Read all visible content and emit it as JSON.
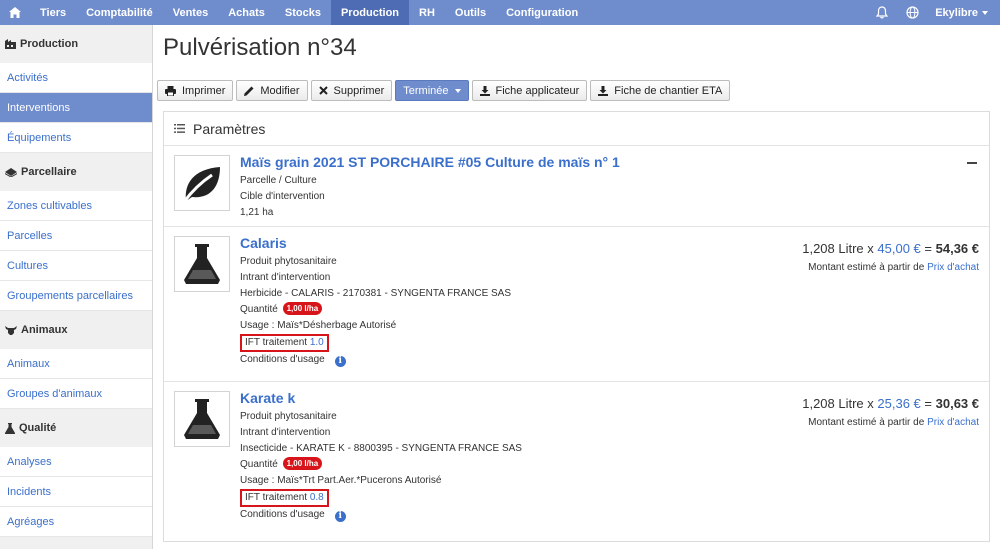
{
  "nav": {
    "items": [
      "Tiers",
      "Comptabilité",
      "Ventes",
      "Achats",
      "Stocks",
      "Production",
      "RH",
      "Outils",
      "Configuration"
    ],
    "active": "Production",
    "user": "Ekylibre"
  },
  "sidebar": {
    "groups": [
      {
        "label": "Production",
        "icon": "factory-icon",
        "items": [
          "Activités",
          "Interventions",
          "Équipements"
        ]
      },
      {
        "label": "Parcellaire",
        "icon": "land-icon",
        "items": [
          "Zones cultivables",
          "Parcelles",
          "Cultures",
          "Groupements parcellaires"
        ]
      },
      {
        "label": "Animaux",
        "icon": "cow-icon",
        "items": [
          "Animaux",
          "Groupes d'animaux"
        ]
      },
      {
        "label": "Qualité",
        "icon": "flask-icon",
        "items": [
          "Analyses",
          "Incidents",
          "Agréages"
        ]
      }
    ],
    "active_item": "Interventions"
  },
  "page": {
    "title": "Pulvérisation n°34"
  },
  "toolbar": {
    "print": "Imprimer",
    "edit": "Modifier",
    "delete": "Supprimer",
    "status": "Terminée",
    "applicator_sheet": "Fiche applicateur",
    "eta_sheet": "Fiche de chantier ETA"
  },
  "panel": {
    "title": "Paramètres"
  },
  "target": {
    "name": "Maïs grain 2021 ST PORCHAIRE #05 Culture de maïs n° 1",
    "type": "Parcelle / Culture",
    "role": "Cible d'intervention",
    "area": "1,21 ha"
  },
  "products": [
    {
      "name": "Calaris",
      "type": "Produit phytosanitaire",
      "role": "Intrant d'intervention",
      "detail": "Herbicide - CALARIS - 2170381 - SYNGENTA FRANCE SAS",
      "quantity_label": "Quantité",
      "quantity": "1,00 l/ha",
      "usage_label": "Usage",
      "usage": "Maïs*Désherbage Autorisé",
      "ift_label": "IFT traitement",
      "ift": "1.0",
      "conditions_label": "Conditions d'usage",
      "qty_text": "1,208 Litre x",
      "unit_price": "45,00 €",
      "equals": "=",
      "total": "54,36 €",
      "note": "Montant estimé à partir de",
      "note_link": "Prix d'achat"
    },
    {
      "name": "Karate k",
      "type": "Produit phytosanitaire",
      "role": "Intrant d'intervention",
      "detail": "Insecticide - KARATE K - 8800395 - SYNGENTA FRANCE SAS",
      "quantity_label": "Quantité",
      "quantity": "1,00 l/ha",
      "usage_label": "Usage",
      "usage": "Maïs*Trt Part.Aer.*Pucerons Autorisé",
      "ift_label": "IFT traitement",
      "ift": "0.8",
      "conditions_label": "Conditions d'usage",
      "qty_text": "1,208 Litre x",
      "unit_price": "25,36 €",
      "equals": "=",
      "total": "30,63 €",
      "note": "Montant estimé à partir de",
      "note_link": "Prix d'achat"
    }
  ],
  "colors": {
    "nav": "#6f8ccc",
    "active": "#4e6cb3",
    "link": "#3a6fcb",
    "badge": "#d7141a"
  }
}
